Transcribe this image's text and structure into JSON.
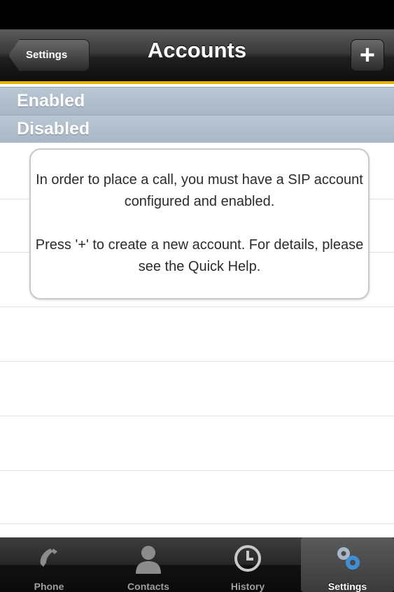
{
  "nav": {
    "title": "Accounts",
    "back_label": "Settings",
    "add_label": "+"
  },
  "sections": {
    "enabled": "Enabled",
    "disabled": "Disabled"
  },
  "message": {
    "line1": "In order to place a call, you must have a SIP account configured and enabled.",
    "line2": "Press '+' to create a new account. For details, please see the Quick Help."
  },
  "tabs": [
    {
      "label": "Phone",
      "icon": "phone-icon",
      "active": false
    },
    {
      "label": "Contacts",
      "icon": "contacts-icon",
      "active": false
    },
    {
      "label": "History",
      "icon": "clock-icon",
      "active": false
    },
    {
      "label": "Settings",
      "icon": "gears-icon",
      "active": true
    }
  ],
  "colors": {
    "accent": "#e2b400",
    "section_header": "#b0bfcd"
  }
}
